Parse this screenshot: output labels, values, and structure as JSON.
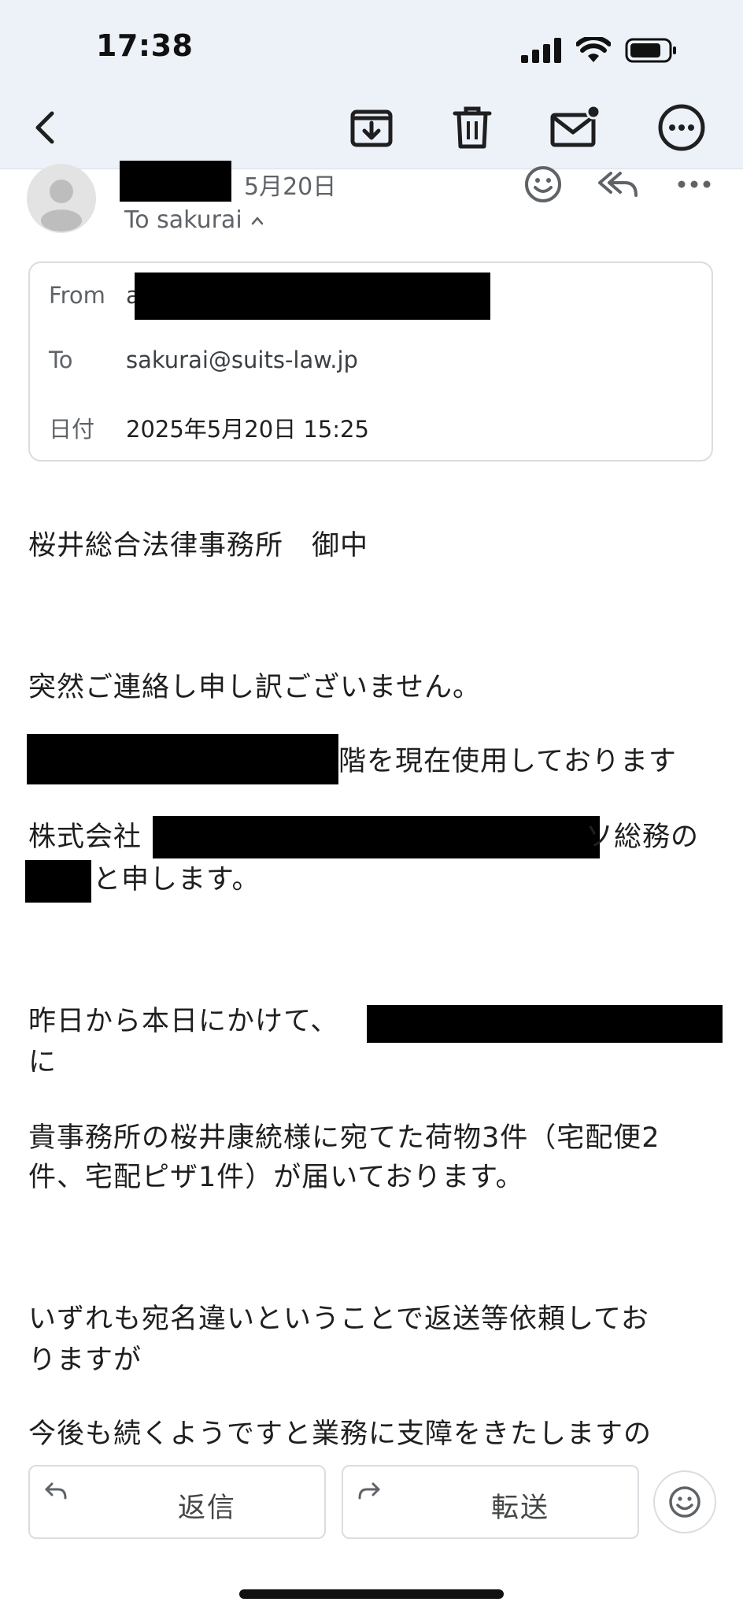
{
  "status_bar": {
    "time": "17:38"
  },
  "toolbar": {
    "back_icon": "chevron-left-icon",
    "archive_icon": "archive-icon",
    "delete_icon": "trash-icon",
    "mark_unread_icon": "mail-unread-icon",
    "more_icon": "more-circle-icon"
  },
  "message": {
    "date": "5月20日",
    "to_label": "To sakurai",
    "details": {
      "from_label": "From",
      "from_value_prefix": "a",
      "to_label": "To",
      "to_value": "sakurai@suits-law.jp",
      "date_label": "日付",
      "date_value": "2025年5月20日 15:25"
    },
    "body_lines": {
      "l1": "桜井総合法律事務所　御中",
      "l2": "突然ご連絡し申し訳ございません。",
      "l3": "階を現在使用しております",
      "l4_prefix": "株式会社",
      "l4_suffix": "ソ総務の",
      "l5": "と申します。",
      "l6": "昨日から本日にかけて、",
      "l7": "に",
      "l8": "貴事務所の桜井康統様に宛てた荷物3件（宅配便2",
      "l9": "件、宅配ピザ1件）が届いております。",
      "l10": "いずれも宛名違いということで返送等依頼してお",
      "l11": "りますが",
      "l12": "今後も続くようですと業務に支障をきたしますの"
    }
  },
  "actions": {
    "reply_label": "返信",
    "forward_label": "転送"
  },
  "colors": {
    "toolbar_bg": "#edf2f9",
    "secondary_text": "#5f6368",
    "border": "#dadce0"
  }
}
